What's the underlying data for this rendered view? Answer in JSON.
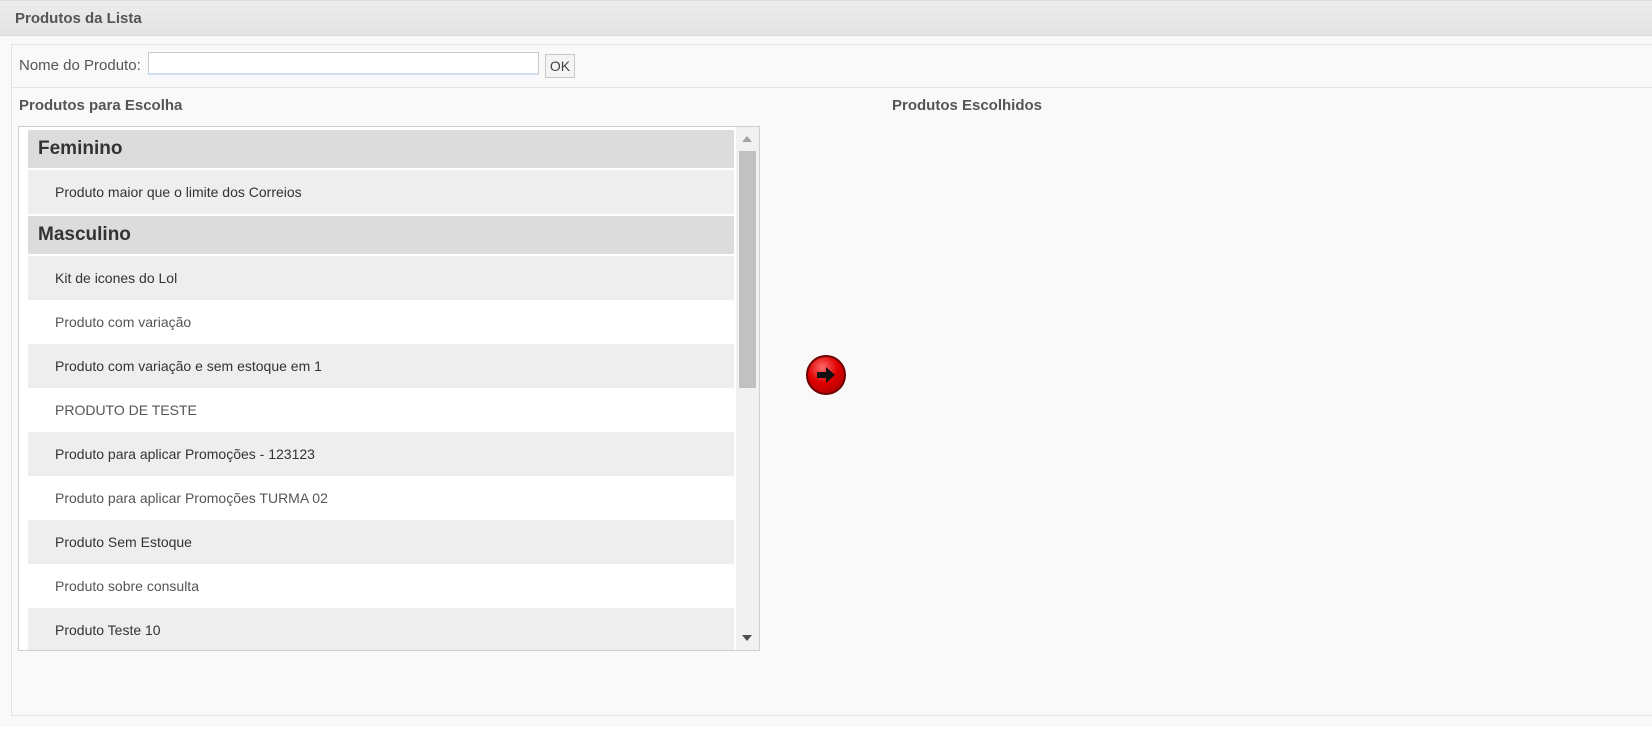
{
  "panel": {
    "title": "Produtos da Lista"
  },
  "search": {
    "label": "Nome do Produto:",
    "value": "",
    "placeholder": "",
    "ok_label": "OK"
  },
  "available": {
    "title": "Produtos para Escolha",
    "groups": [
      {
        "name": "Feminino",
        "items": [
          "Produto maior que o limite dos Correios"
        ]
      },
      {
        "name": "Masculino",
        "items": [
          "Kit de icones do Lol",
          "Produto com variação",
          "Produto com variação e sem estoque em 1",
          "PRODUTO DE TESTE",
          "Produto para aplicar Promoções - 123123",
          "Produto para aplicar Promoções TURMA 02",
          "Produto Sem Estoque",
          "Produto sobre consulta",
          "Produto Teste 10"
        ]
      }
    ]
  },
  "chosen": {
    "title": "Produtos Escolhidos",
    "items": []
  },
  "icons": {
    "move": "arrow-right-icon",
    "scroll_up": "scroll-up-arrow-icon",
    "scroll_down": "scroll-down-arrow-icon"
  },
  "colors": {
    "accent": "#e00000",
    "header_bg": "#e6e6e6",
    "group_bg": "#dcdcdc",
    "item_shaded": "#eeeeee"
  }
}
